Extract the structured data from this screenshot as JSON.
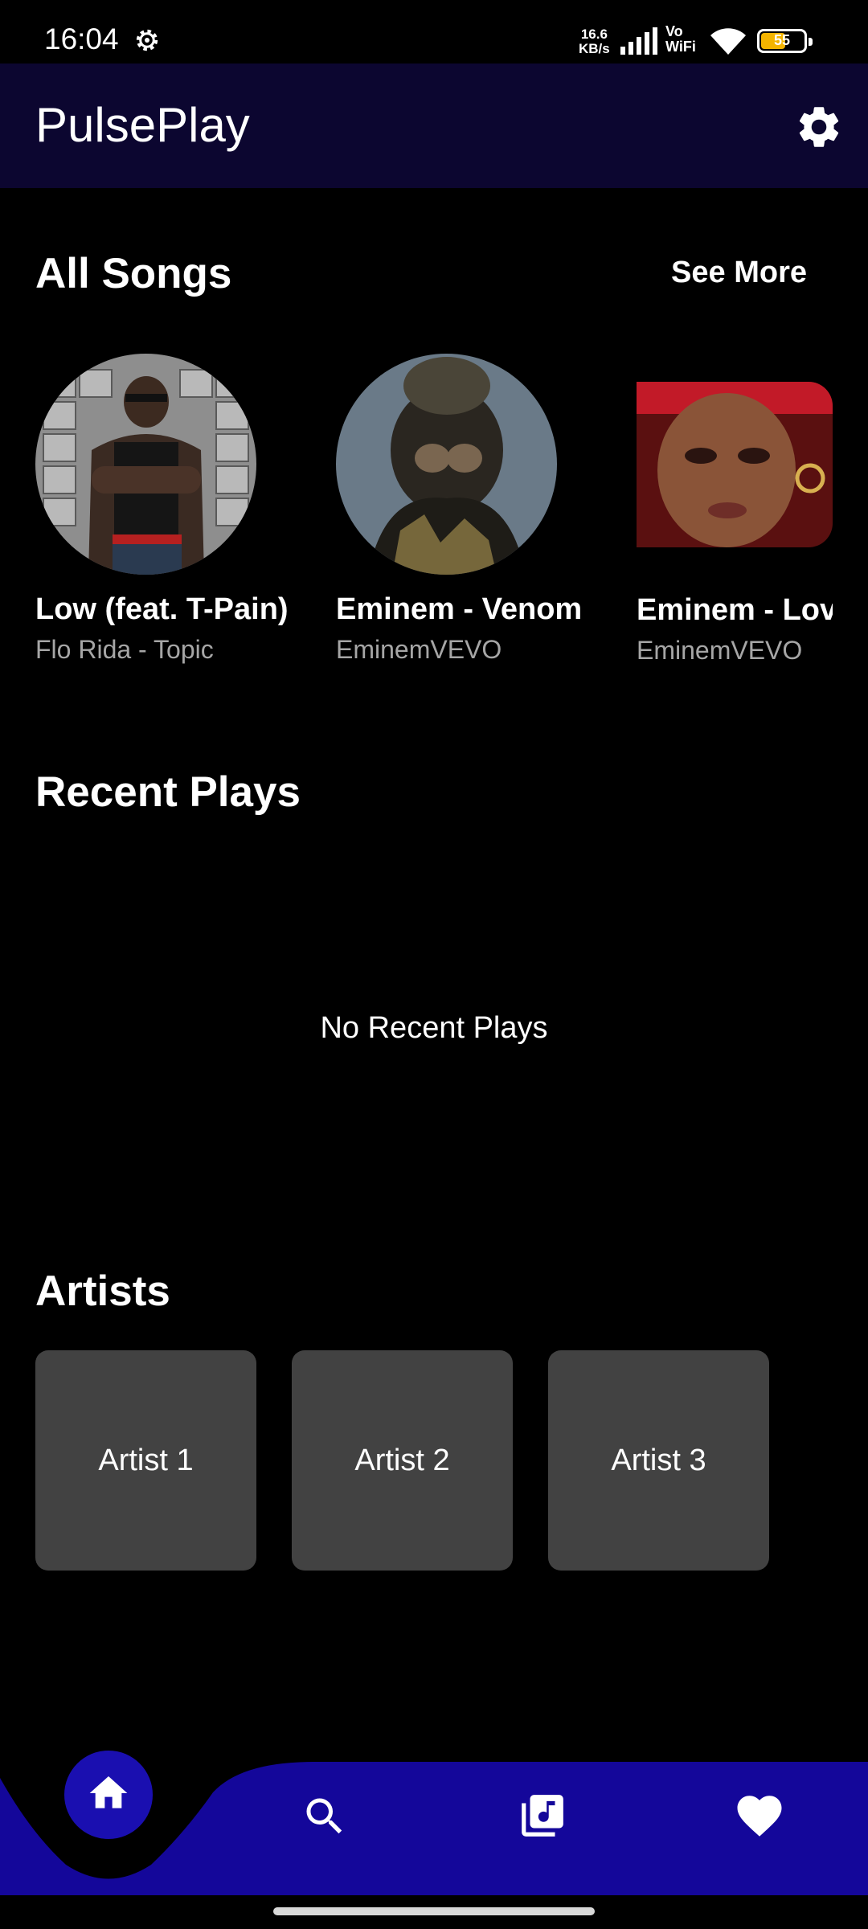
{
  "status_bar": {
    "time": "16:04",
    "speed_value": "16.6",
    "speed_unit": "KB/s",
    "vowifi_top": "Vo",
    "vowifi_bottom": "WiFi",
    "battery_level": "55"
  },
  "app_bar": {
    "title": "PulsePlay",
    "settings_icon": "gear-icon"
  },
  "all_songs": {
    "title": "All Songs",
    "see_more_label": "See More",
    "songs": [
      {
        "title": "Low (feat. T-Pain)",
        "artist": "Flo Rida - Topic"
      },
      {
        "title": "Eminem - Venom",
        "artist": "EminemVEVO"
      },
      {
        "title": "Eminem - Lov",
        "artist": "EminemVEVO"
      }
    ]
  },
  "recent_plays": {
    "title": "Recent Plays",
    "empty_message": "No Recent Plays"
  },
  "artists": {
    "title": "Artists",
    "items": [
      {
        "label": "Artist 1"
      },
      {
        "label": "Artist 2"
      },
      {
        "label": "Artist 3"
      }
    ]
  },
  "bottom_nav": {
    "items": [
      "home-icon",
      "search-icon",
      "library-music-icon",
      "heart-icon"
    ],
    "active": "home-icon",
    "bar_color": "#14079a",
    "active_color": "#1a0fb0"
  }
}
